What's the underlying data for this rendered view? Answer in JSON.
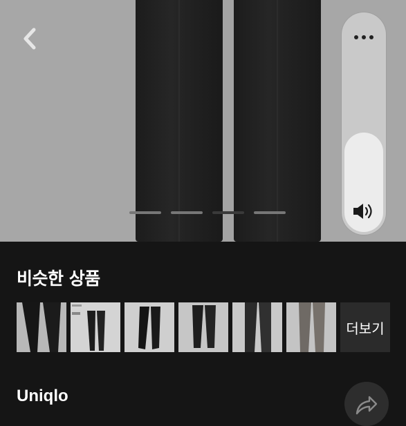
{
  "hero": {
    "image_alt": "",
    "pager": {
      "total": 4,
      "active_index": 2
    }
  },
  "volume_overlay": {
    "level": 0.46,
    "more_icon": "more-horizontal-icon",
    "speaker_icon": "speaker-icon"
  },
  "similar_products": {
    "title": "비슷한 상품",
    "more_label": "더보기",
    "thumbnails": [
      {
        "name": "thumb-1"
      },
      {
        "name": "thumb-2"
      },
      {
        "name": "thumb-3"
      },
      {
        "name": "thumb-4"
      },
      {
        "name": "thumb-5"
      },
      {
        "name": "thumb-6"
      }
    ]
  },
  "product": {
    "brand": "Uniqlo"
  },
  "icons": {
    "back": "chevron-left-icon",
    "share": "share-icon"
  },
  "colors": {
    "background": "#151515",
    "hero_bg": "#a7a7a7",
    "overlay": "#c9c9c9",
    "overlay_fill": "#ececec"
  }
}
